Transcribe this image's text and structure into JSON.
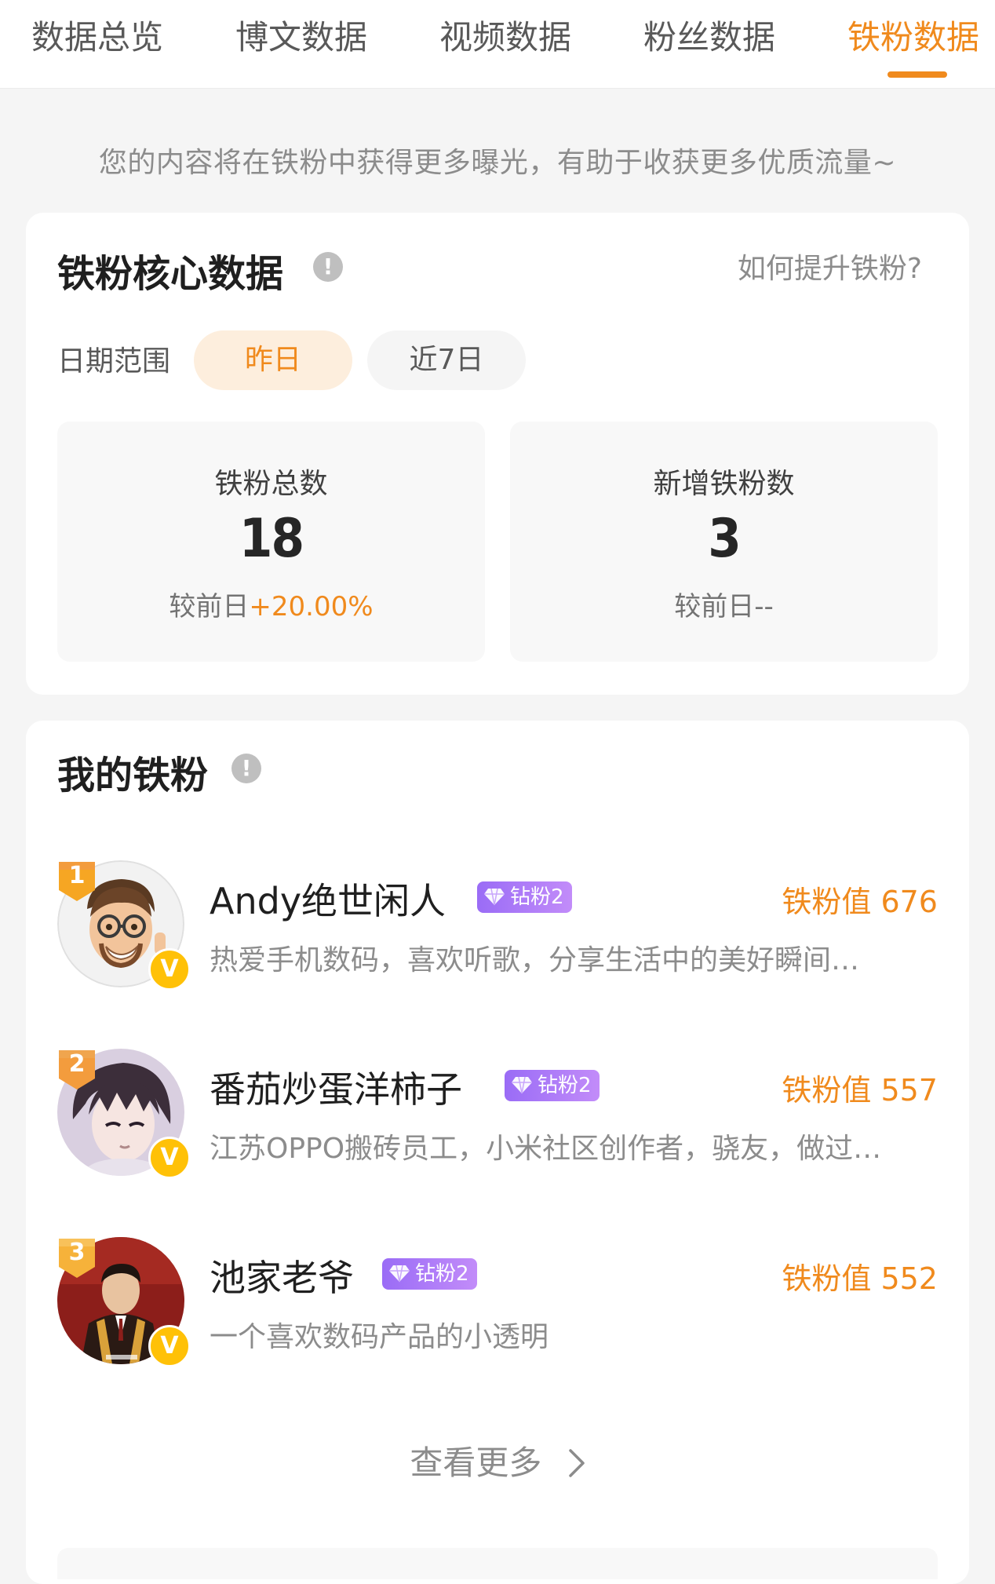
{
  "tabs": [
    {
      "label": "数据总览"
    },
    {
      "label": "博文数据"
    },
    {
      "label": "视频数据"
    },
    {
      "label": "粉丝数据"
    },
    {
      "label": "铁粉数据"
    }
  ],
  "active_tab_index": 4,
  "banner": "您的内容将在铁粉中获得更多曝光，有助于收获更多优质流量~",
  "core": {
    "title": "铁粉核心数据",
    "help_link": "如何提升铁粉?",
    "date_range_label": "日期范围",
    "date_options": [
      {
        "label": "昨日",
        "selected": true
      },
      {
        "label": "近7日",
        "selected": false
      }
    ],
    "stats": [
      {
        "label": "铁粉总数",
        "value": "18",
        "compare_prefix": "较前日",
        "compare_value": "+20.00%"
      },
      {
        "label": "新增铁粉数",
        "value": "3",
        "compare_prefix": "较前日",
        "compare_value": "--"
      }
    ]
  },
  "fans": {
    "title": "我的铁粉",
    "items": [
      {
        "rank": "1",
        "name": "Andy绝世闲人",
        "level": "钻粉2",
        "score": "铁粉值 676",
        "bio": "热爱手机数码，喜欢听歌，分享生活中的美好瞬间…",
        "verify": "V"
      },
      {
        "rank": "2",
        "name": "番茄炒蛋洋柿子",
        "level": "钻粉2",
        "score": "铁粉值 557",
        "bio": "江苏OPPO搬砖员工，小米社区创作者，骁友，做过…",
        "verify": "V"
      },
      {
        "rank": "3",
        "name": "池家老爷",
        "level": "钻粉2",
        "score": "铁粉值 552",
        "bio": "一个喜欢数码产品的小透明",
        "verify": "V"
      }
    ],
    "view_more": "查看更多"
  },
  "colors": {
    "accent": "#f08a1d",
    "accent_soft": "#fdeedd",
    "level_badge": "#9a6cf6",
    "verify_badge": "#ffc107",
    "rank_gold": "#f6a623",
    "rank_orange": "#f39c3d",
    "rank_red": "#f06a2a"
  },
  "icons": {
    "info": "exclamation-circle-icon",
    "level_gem": "diamond-icon",
    "verify": "v-badge-icon",
    "view_more": "chevron-right-icon"
  }
}
